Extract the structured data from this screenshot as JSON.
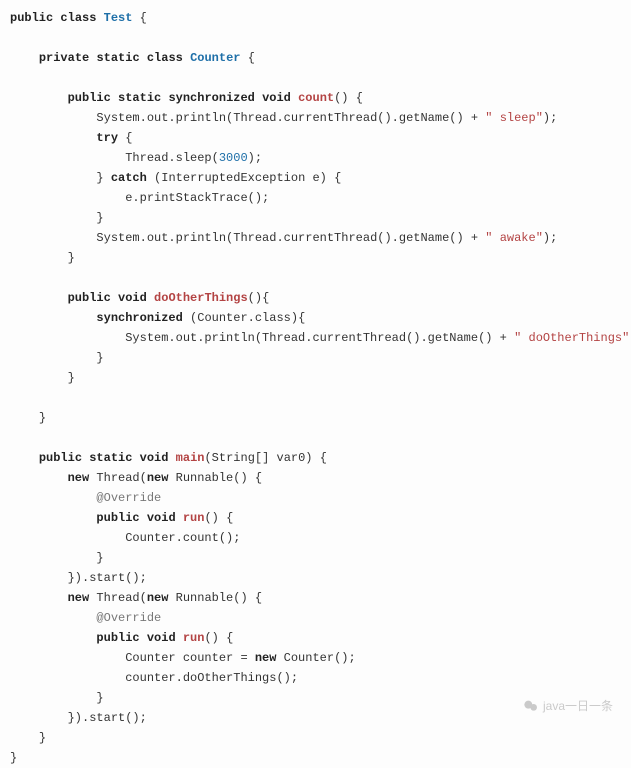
{
  "code": {
    "kw_public": "public",
    "kw_class": "class",
    "cls_Test": "Test",
    "brace_o": "{",
    "brace_c": "}",
    "kw_private": "private",
    "kw_static": "static",
    "cls_Counter": "Counter",
    "kw_synchronized": "synchronized",
    "kw_void": "void",
    "meth_count": "count",
    "paren_empty": "()",
    "ln_print_sleep_a": "System.out.println(Thread.currentThread().getName() + ",
    "str_sleep": "\" sleep\"",
    "ln_print_sleep_b": ");",
    "kw_try": "try",
    "ln_sleep_a": "Thread.sleep(",
    "num_3000": "3000",
    "ln_sleep_b": ");",
    "kw_catch": "catch",
    "ln_catch_param": " (InterruptedException e) {",
    "ln_stacktrace": "e.printStackTrace();",
    "ln_print_awake_a": "System.out.println(Thread.currentThread().getName() + ",
    "str_awake": "\" awake\"",
    "ln_print_awake_b": ");",
    "meth_other": "doOtherThings",
    "ln_other_sig": "(){",
    "ln_sync_a": " (Counter.class){",
    "ln_print_other_a": "System.out.println(Thread.currentThread().getName() + ",
    "str_other": "\" doOtherThings\"",
    "ln_print_other_b": ");",
    "meth_main": "main",
    "ln_main_sig": "(String[] var0) {",
    "kw_new": "new",
    "ln_thread": " Thread(",
    "ln_runnable": " Runnable() {",
    "ann_override": "@Override",
    "meth_run": "run",
    "ln_run_sig": "() {",
    "ln_callcount": "Counter.count();",
    "ln_startend": "}).start();",
    "ln_newcounter_a": "Counter counter = ",
    "ln_newcounter_b": " Counter();",
    "ln_callother": "counter.doOtherThings();"
  },
  "watermark": "java一日一条"
}
